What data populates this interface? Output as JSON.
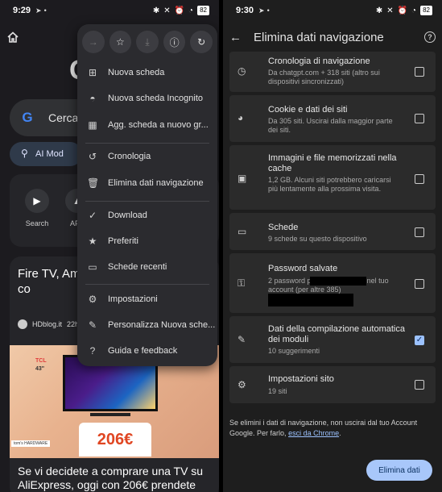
{
  "left": {
    "status": {
      "time": "9:29",
      "battery": "82"
    },
    "search_text": "Cerca co",
    "ai_mode_label": "AI Mod",
    "shortcuts": [
      {
        "label": "Search"
      },
      {
        "label": "APK"
      }
    ],
    "article": {
      "title": "Fire TV, Ama abbandona A dispositivi co",
      "source": "HDblog.it",
      "time": "22h",
      "tv_brand": "TCL",
      "tv_size": "43\"",
      "price": "206€",
      "brand_tag": "tom's HARDWARE",
      "next_title": "Se vi decidete a comprare una TV su AliExpress, oggi con 206€ prendete"
    },
    "menu": {
      "top_icons": [
        "forward-icon",
        "star-icon",
        "download-icon",
        "info-icon",
        "refresh-icon"
      ],
      "items": [
        {
          "label": "Nuova scheda",
          "icon": "plus-box-icon"
        },
        {
          "label": "Nuova scheda Incognito",
          "icon": "incognito-icon"
        },
        {
          "label": "Agg. scheda a nuovo gr...",
          "icon": "tab-group-icon"
        },
        {
          "label": "Cronologia",
          "icon": "history-icon"
        },
        {
          "label": "Elimina dati navigazione",
          "icon": "trash-icon"
        },
        {
          "label": "Download",
          "icon": "download-check-icon"
        },
        {
          "label": "Preferiti",
          "icon": "star-filled-icon"
        },
        {
          "label": "Schede recenti",
          "icon": "devices-icon"
        },
        {
          "label": "Impostazioni",
          "icon": "gear-icon"
        },
        {
          "label": "Personalizza Nuova sche...",
          "icon": "pencil-icon"
        },
        {
          "label": "Guida e feedback",
          "icon": "help-icon"
        }
      ]
    }
  },
  "right": {
    "status": {
      "time": "9:30",
      "battery": "82"
    },
    "title": "Elimina dati navigazione",
    "rows": [
      {
        "title": "Cronologia di navigazione",
        "sub": "Da chatgpt.com + 318 siti (altro sui dispositivi sincronizzati)",
        "checked": false,
        "icon": "clock-icon"
      },
      {
        "title": "Cookie e dati dei siti",
        "sub": "Da 305 siti. Uscirai dalla maggior parte dei siti.",
        "checked": false,
        "icon": "cookie-icon"
      },
      {
        "title": "Immagini e file memorizzati nella cache",
        "sub": "1,2 GB. Alcuni siti potrebbero caricarsi più lentamente alla prossima visita.",
        "checked": false,
        "icon": "image-icon"
      },
      {
        "title": "Schede",
        "sub": "9 schede su questo dispositivo",
        "checked": false,
        "icon": "tab-icon"
      },
      {
        "title": "Password salvate",
        "sub": "2 password per          387 password nel tuo account (per          altre 385)",
        "checked": false,
        "icon": "key-icon"
      },
      {
        "title": "Dati della compilazione automatica dei moduli",
        "sub": "10 suggerimenti",
        "checked": true,
        "icon": "pencil-icon"
      },
      {
        "title": "Impostazioni sito",
        "sub": "19 siti",
        "checked": false,
        "icon": "site-settings-icon"
      }
    ],
    "footer_text": "Se elimini i dati di navigazione, non uscirai dal tuo Account Google. Per farlo,",
    "footer_link": "esci da Chrome",
    "footer_end": ".",
    "clear_button": "Elimina dati"
  }
}
